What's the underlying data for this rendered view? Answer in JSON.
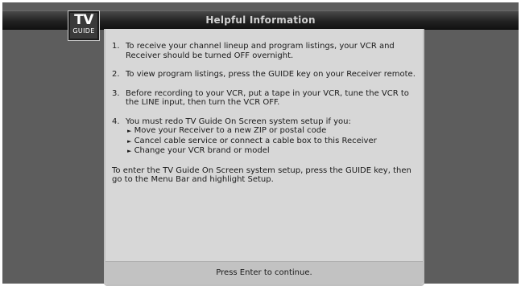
{
  "header": {
    "title": "Helpful Information",
    "logo": {
      "line1": "TV",
      "line2": "GUIDE"
    }
  },
  "tips": [
    {
      "num": "1.",
      "text": "To receive your channel lineup and program listings, your VCR and Receiver should be turned OFF overnight."
    },
    {
      "num": "2.",
      "text": "To view program listings, press the GUIDE key on your Receiver remote."
    },
    {
      "num": "3.",
      "text": "Before recording to your VCR, put a tape in your VCR, tune the VCR to the LINE input, then turn the VCR OFF."
    },
    {
      "num": "4.",
      "text": "You must redo TV Guide On Screen system setup if you:",
      "subitems": [
        "Move your Receiver to a new ZIP or postal code",
        "Cancel cable service or connect a cable box to this Receiver",
        "Change your VCR brand or model"
      ]
    }
  ],
  "closing": "To enter the TV Guide On Screen system setup, press the GUIDE key, then go to the Menu Bar and highlight Setup.",
  "footer": {
    "prompt": "Press Enter to continue."
  },
  "colors": {
    "background": "#5d5d5d",
    "title_bar": "#232323",
    "panel": "#d7d7d7",
    "footer": "#c2c2c2",
    "text": "#1a1a1a"
  },
  "icons": {
    "bullet": "triangle-right-icon"
  }
}
